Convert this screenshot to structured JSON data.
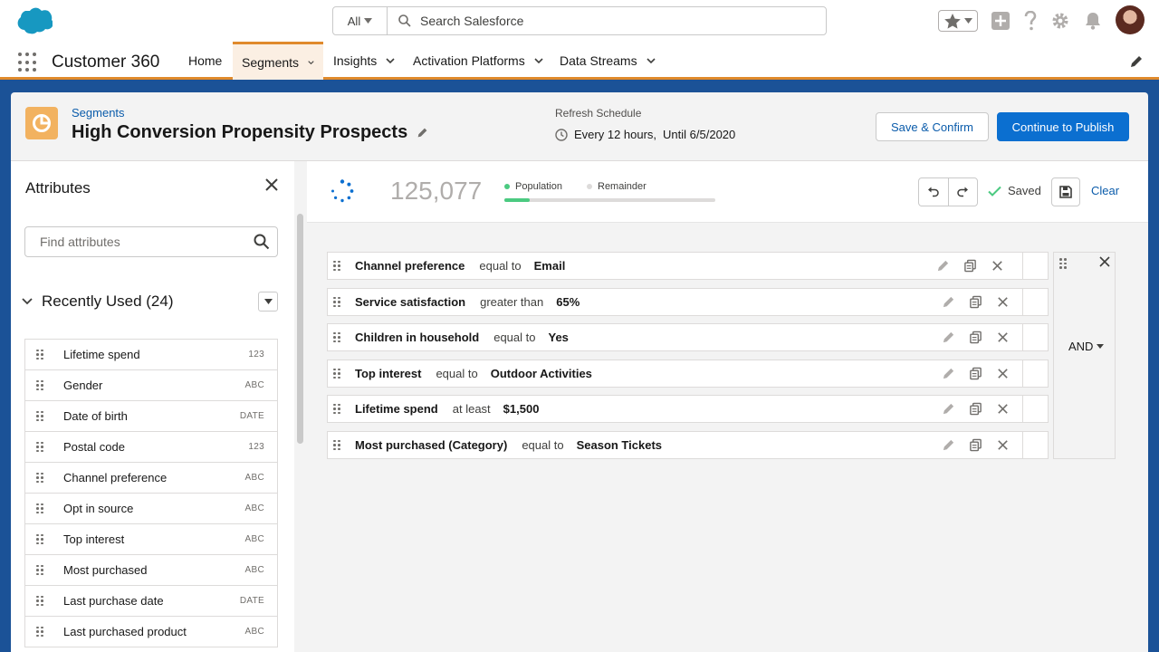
{
  "header": {
    "search_scope": "All",
    "search_placeholder": "Search Salesforce"
  },
  "nav": {
    "app_name": "Customer 360",
    "items": [
      {
        "label": "Home",
        "has_menu": false,
        "active": false
      },
      {
        "label": "Segments",
        "has_menu": true,
        "active": true
      },
      {
        "label": "Insights",
        "has_menu": true,
        "active": false
      },
      {
        "label": "Activation Platforms",
        "has_menu": true,
        "active": false
      },
      {
        "label": "Data Streams",
        "has_menu": true,
        "active": false
      }
    ]
  },
  "page": {
    "breadcrumb": "Segments",
    "title": "High Conversion Propensity Prospects",
    "refresh_label": "Refresh Schedule",
    "refresh_frequency": "Every 12 hours,",
    "refresh_until": "Until 6/5/2020",
    "save_button": "Save & Confirm",
    "publish_button": "Continue to Publish"
  },
  "sidebar": {
    "title": "Attributes",
    "search_placeholder": "Find attributes",
    "section_label": "Recently Used (24)",
    "attributes": [
      {
        "name": "Lifetime spend",
        "type": "123"
      },
      {
        "name": "Gender",
        "type": "ABC"
      },
      {
        "name": "Date of birth",
        "type": "DATE"
      },
      {
        "name": "Postal code",
        "type": "123"
      },
      {
        "name": "Channel preference",
        "type": "ABC"
      },
      {
        "name": "Opt in source",
        "type": "ABC"
      },
      {
        "name": "Top interest",
        "type": "ABC"
      },
      {
        "name": "Most purchased",
        "type": "ABC"
      },
      {
        "name": "Last purchase date",
        "type": "DATE"
      },
      {
        "name": "Last purchased product",
        "type": "ABC"
      }
    ]
  },
  "stats": {
    "count": "125,077",
    "population_label": "Population",
    "remainder_label": "Remainder",
    "population_fraction": 0.12,
    "saved_label": "Saved",
    "clear_label": "Clear"
  },
  "rules": [
    {
      "field": "Channel preference",
      "operator": "equal to",
      "value": "Email"
    },
    {
      "field": "Service satisfaction",
      "operator": "greater than",
      "value": "65%"
    },
    {
      "field": "Children in household",
      "operator": "equal to",
      "value": "Yes"
    },
    {
      "field": "Top interest",
      "operator": "equal to",
      "value": "Outdoor Activities"
    },
    {
      "field": "Lifetime spend",
      "operator": "at least",
      "value": "$1,500"
    },
    {
      "field": "Most purchased (Category)",
      "operator": "equal to",
      "value": "Season Tickets"
    }
  ],
  "logic": {
    "operator": "AND"
  },
  "colors": {
    "brand": "#0b6fd0",
    "accent_orange": "#e08a2c",
    "population_green": "#4bca81",
    "segment_icon": "#f2b260"
  },
  "icons": [
    "salesforce-cloud-icon",
    "search-icon",
    "favorites-star-icon",
    "add-icon",
    "help-icon",
    "setup-gear-icon",
    "notifications-bell-icon",
    "app-launcher-icon",
    "edit-pencil-icon",
    "segment-pie-icon",
    "clock-icon",
    "close-icon",
    "chevron-down-icon",
    "drag-handle-icon",
    "undo-icon",
    "redo-icon",
    "checkmark-icon",
    "save-disk-icon",
    "copy-icon",
    "spinner-icon"
  ]
}
